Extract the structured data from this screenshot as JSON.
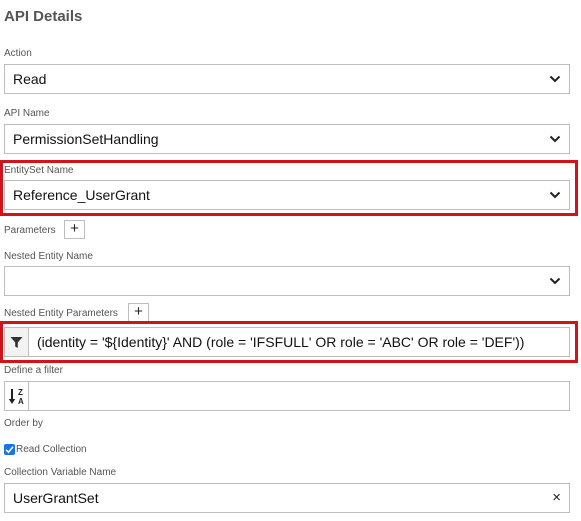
{
  "panel": {
    "title": "API Details"
  },
  "action": {
    "label": "Action",
    "value": "Read"
  },
  "api_name": {
    "label": "API Name",
    "value": "PermissionSetHandling"
  },
  "entityset": {
    "label": "EntitySet Name",
    "value": "Reference_UserGrant"
  },
  "parameters": {
    "label": "Parameters",
    "add_label": "+"
  },
  "nested_entity": {
    "label": "Nested Entity Name",
    "value": ""
  },
  "nested_params": {
    "label": "Nested Entity Parameters",
    "add_label": "+"
  },
  "filter": {
    "placeholder": "(identity = '${Identity}' AND (role = 'IFSFULL' OR role = 'ABC' OR role = 'DEF'))",
    "hint": "Define a filter"
  },
  "order_by": {
    "value": "",
    "hint": "Order by"
  },
  "read_collection": {
    "label": "Read Collection",
    "checked": true
  },
  "collection_var": {
    "label": "Collection Variable Name",
    "value": "UserGrantSet",
    "clear_label": "×"
  },
  "colors": {
    "highlight": "#d0141c",
    "checkbox": "#1a73e8"
  },
  "icons": [
    "chevron-down-icon",
    "plus-icon",
    "filter-icon",
    "sort-z-a-icon",
    "check-icon",
    "clear-icon"
  ]
}
